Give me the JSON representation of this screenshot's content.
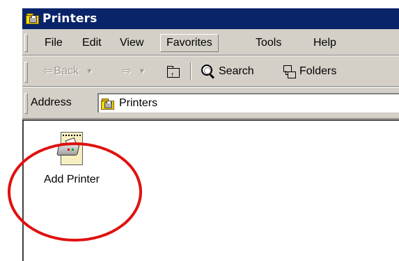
{
  "window": {
    "title": "Printers"
  },
  "menubar": {
    "items": [
      {
        "label": "File"
      },
      {
        "label": "Edit"
      },
      {
        "label": "View"
      },
      {
        "label": "Favorites"
      },
      {
        "label": "Tools"
      },
      {
        "label": "Help"
      }
    ]
  },
  "toolbar": {
    "back_label": "Back",
    "search_label": "Search",
    "folders_label": "Folders"
  },
  "address": {
    "label": "Address",
    "value": "Printers"
  },
  "content": {
    "items": [
      {
        "label": "Add Printer",
        "icon": "add-printer-icon"
      }
    ]
  },
  "annotation": {
    "color": "#e01010",
    "target": "Add Printer"
  }
}
